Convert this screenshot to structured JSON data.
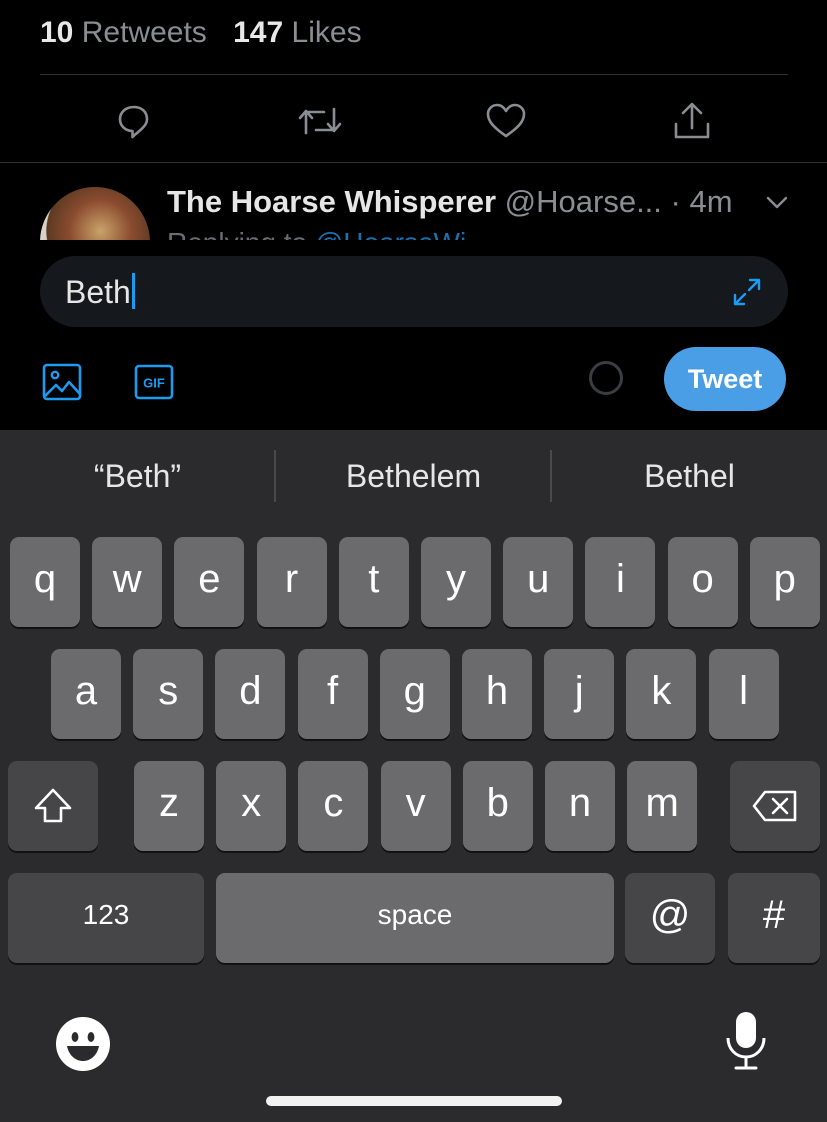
{
  "stats": {
    "retweets_count": "10",
    "retweets_label": "Retweets",
    "likes_count": "147",
    "likes_label": "Likes"
  },
  "actions": [
    "reply-icon",
    "retweet-icon",
    "like-icon",
    "share-icon"
  ],
  "reply": {
    "name": "The Hoarse Whisperer",
    "handle": "@Hoarse...",
    "time": "· 4m",
    "replying_prefix": "Replying to",
    "replying_handle": "@HoarseWi..."
  },
  "compose": {
    "text": "Beth",
    "tweet_label": "Tweet",
    "gif_label": "GIF"
  },
  "keyboard": {
    "suggestions": [
      "“Beth”",
      "Bethelem",
      "Bethel"
    ],
    "row1": [
      "q",
      "w",
      "e",
      "r",
      "t",
      "y",
      "u",
      "i",
      "o",
      "p"
    ],
    "row2": [
      "a",
      "s",
      "d",
      "f",
      "g",
      "h",
      "j",
      "k",
      "l"
    ],
    "row3": [
      "z",
      "x",
      "c",
      "v",
      "b",
      "n",
      "m"
    ],
    "numbers_label": "123",
    "space_label": "space",
    "at_label": "@",
    "hash_label": "#"
  },
  "colors": {
    "accent": "#1d9bf0",
    "tweet_button": "#4a9ee6",
    "keyboard_bg": "#2b2b2d",
    "key": "#6b6b6d",
    "key_dark": "#464648"
  }
}
